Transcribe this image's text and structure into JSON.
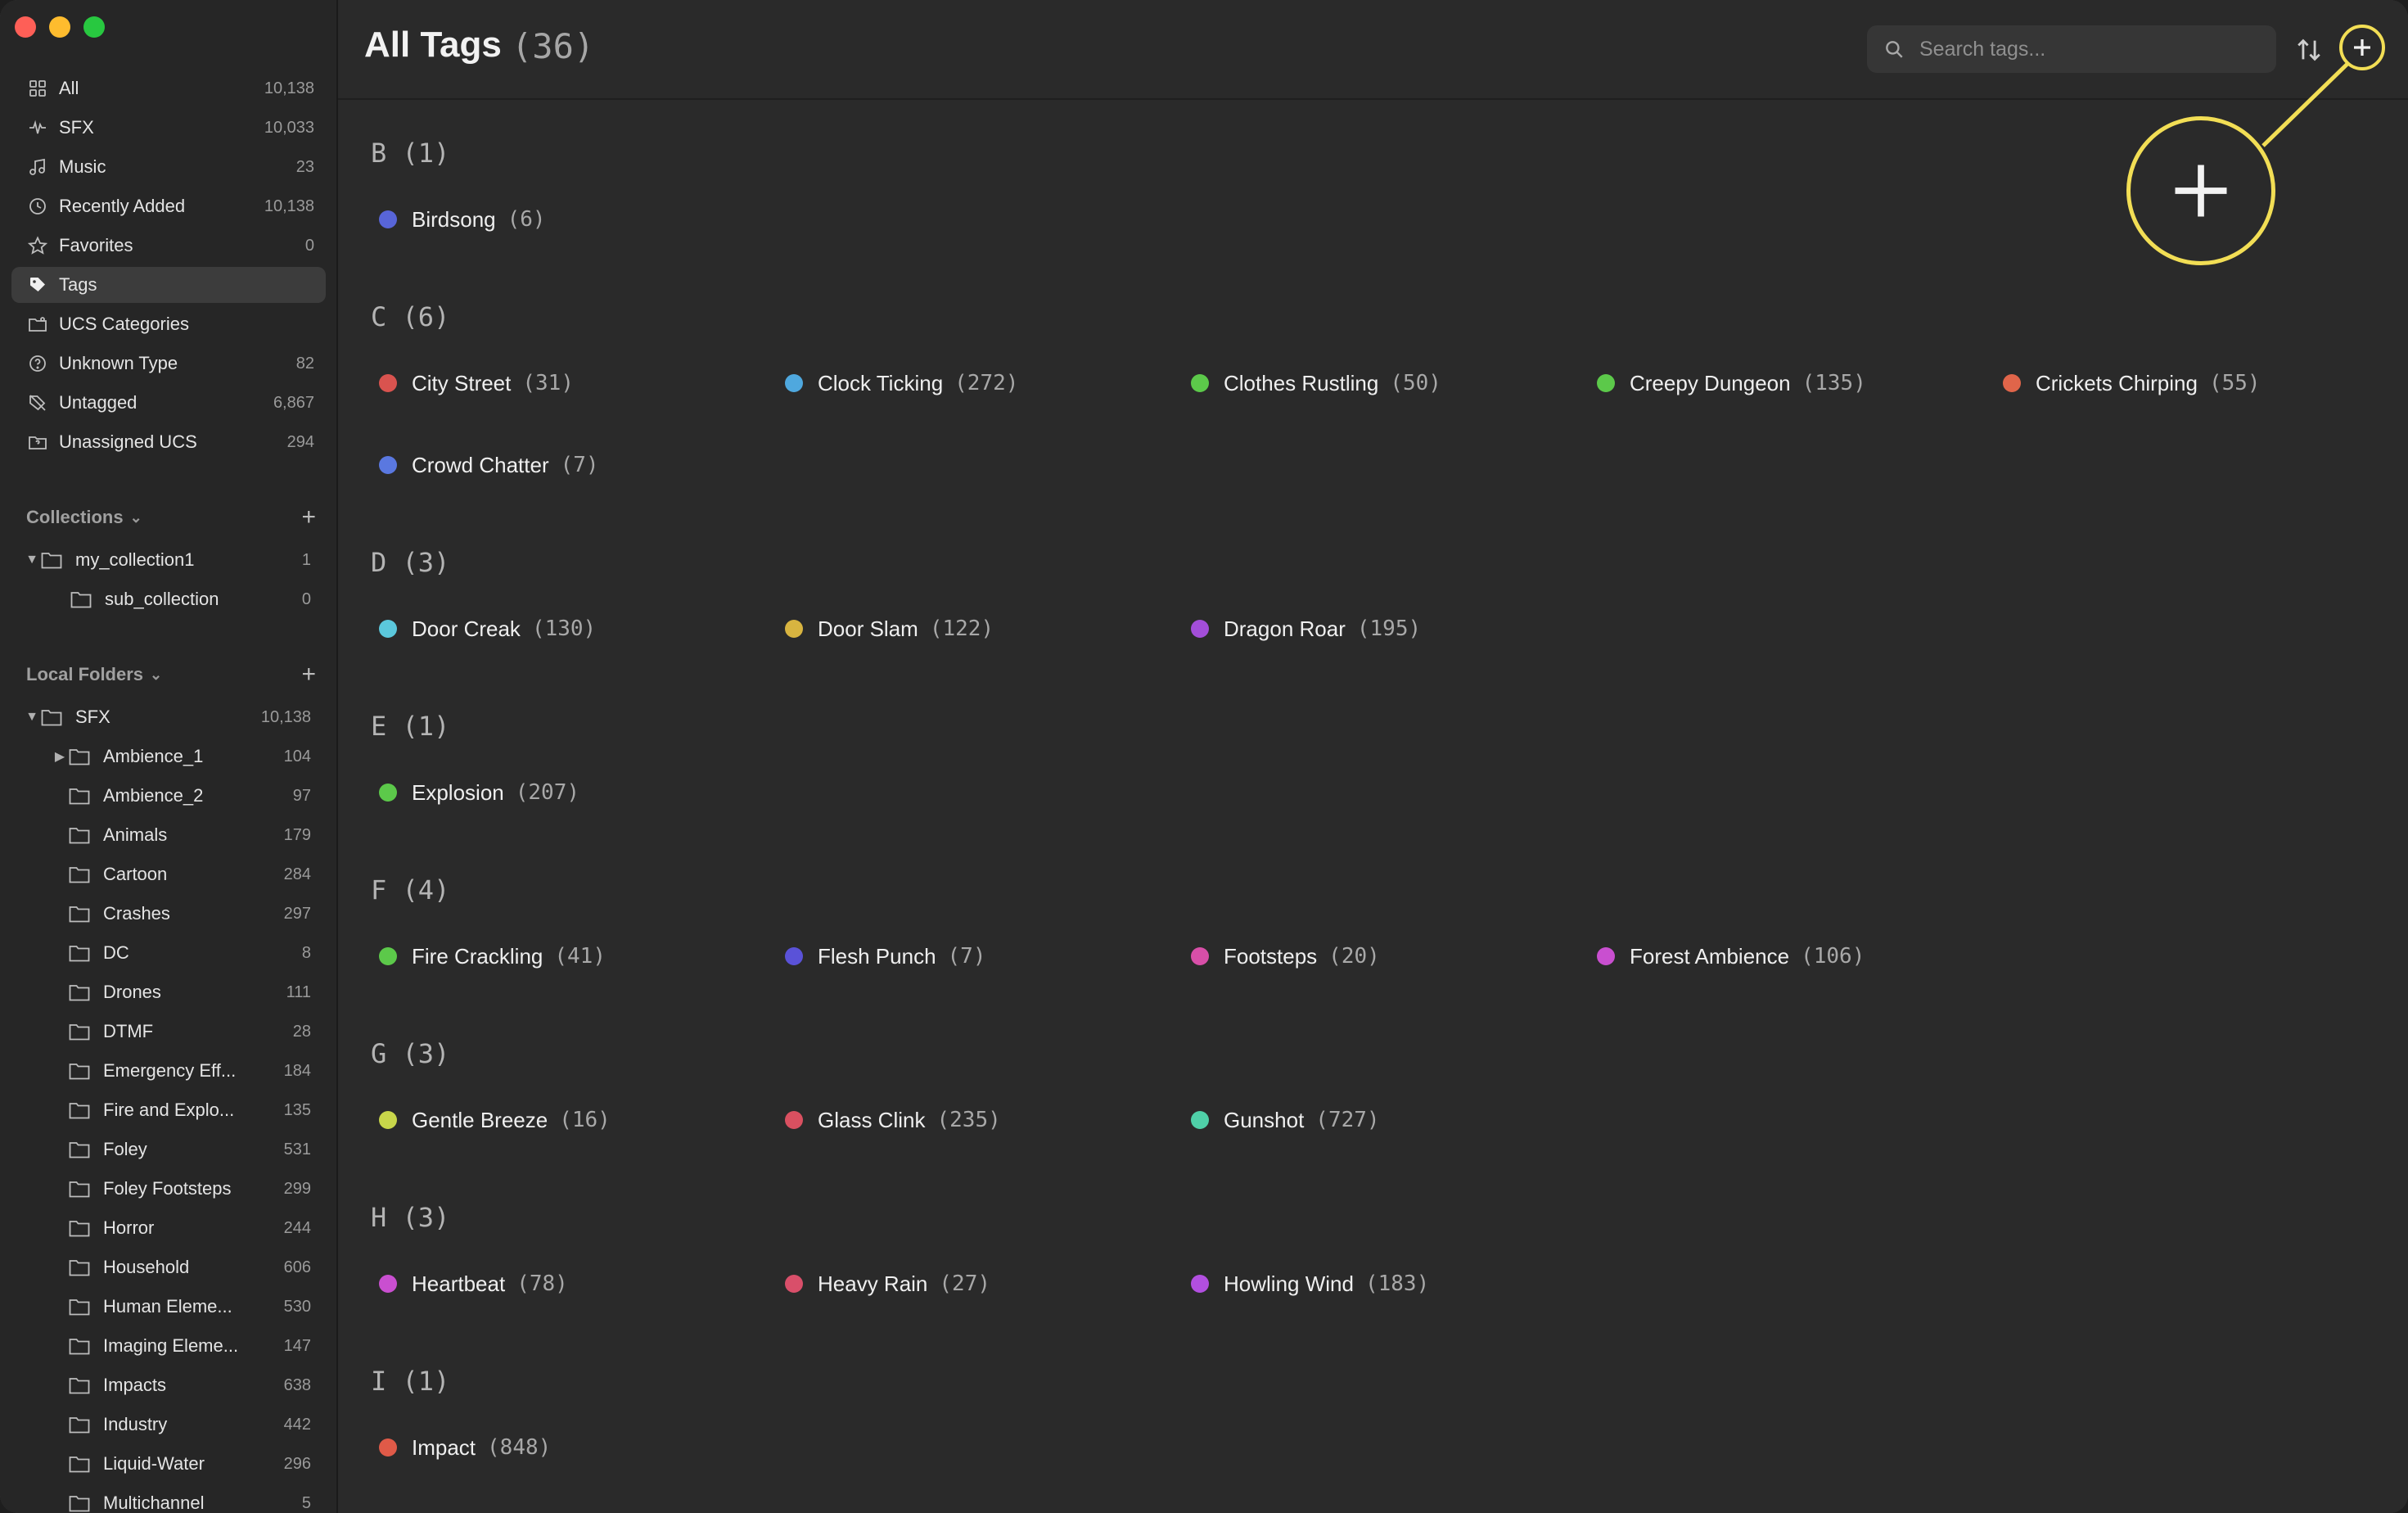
{
  "sidebar": {
    "library": [
      {
        "label": "All",
        "count": "10,138",
        "icon": "grid-icon"
      },
      {
        "label": "SFX",
        "count": "10,033",
        "icon": "waveform-icon"
      },
      {
        "label": "Music",
        "count": "23",
        "icon": "music-note-icon"
      },
      {
        "label": "Recently Added",
        "count": "10,138",
        "icon": "clock-icon"
      },
      {
        "label": "Favorites",
        "count": "0",
        "icon": "star-icon"
      },
      {
        "label": "Tags",
        "count": "",
        "icon": "tag-icon"
      },
      {
        "label": "UCS Categories",
        "count": "",
        "icon": "folder-tag-icon"
      },
      {
        "label": "Unknown Type",
        "count": "82",
        "icon": "question-circle-icon"
      },
      {
        "label": "Untagged",
        "count": "6,867",
        "icon": "tag-slash-icon"
      },
      {
        "label": "Unassigned UCS",
        "count": "294",
        "icon": "folder-question-icon"
      }
    ],
    "collections": {
      "header": "Collections",
      "items": [
        {
          "label": "my_collection1",
          "count": "1"
        },
        {
          "label": "sub_collection",
          "count": "0"
        }
      ]
    },
    "local_folders": {
      "header": "Local Folders",
      "root": {
        "label": "SFX",
        "count": "10,138"
      },
      "items": [
        {
          "label": "Ambience_1",
          "count": "104"
        },
        {
          "label": "Ambience_2",
          "count": "97"
        },
        {
          "label": "Animals",
          "count": "179"
        },
        {
          "label": "Cartoon",
          "count": "284"
        },
        {
          "label": "Crashes",
          "count": "297"
        },
        {
          "label": "DC",
          "count": "8"
        },
        {
          "label": "Drones",
          "count": "111"
        },
        {
          "label": "DTMF",
          "count": "28"
        },
        {
          "label": "Emergency Eff...",
          "count": "184"
        },
        {
          "label": "Fire and Explo...",
          "count": "135"
        },
        {
          "label": "Foley",
          "count": "531"
        },
        {
          "label": "Foley Footsteps",
          "count": "299"
        },
        {
          "label": "Horror",
          "count": "244"
        },
        {
          "label": "Household",
          "count": "606"
        },
        {
          "label": "Human Eleme...",
          "count": "530"
        },
        {
          "label": "Imaging Eleme...",
          "count": "147"
        },
        {
          "label": "Impacts",
          "count": "638"
        },
        {
          "label": "Industry",
          "count": "442"
        },
        {
          "label": "Liquid-Water",
          "count": "296"
        },
        {
          "label": "Multichannel",
          "count": "5"
        }
      ]
    }
  },
  "header": {
    "title": "All Tags",
    "count": "(36)",
    "search_placeholder": "Search tags..."
  },
  "groups": [
    {
      "heading": "B (1)",
      "tags": [
        {
          "name": "Birdsong",
          "count": "(6)",
          "color": "#5865d8"
        }
      ]
    },
    {
      "heading": "C (6)",
      "tags": [
        {
          "name": "City Street",
          "count": "(31)",
          "color": "#d9534f"
        },
        {
          "name": "Clock Ticking",
          "count": "(272)",
          "color": "#4fa8de"
        },
        {
          "name": "Clothes Rustling",
          "count": "(50)",
          "color": "#5cc94a"
        },
        {
          "name": "Creepy Dungeon",
          "count": "(135)",
          "color": "#5cc94a"
        },
        {
          "name": "Crickets Chirping",
          "count": "(55)",
          "color": "#e0654a"
        },
        {
          "name": "Crowd Chatter",
          "count": "(7)",
          "color": "#5a78e0"
        }
      ]
    },
    {
      "heading": "D (3)",
      "tags": [
        {
          "name": "Door Creak",
          "count": "(130)",
          "color": "#5bc8dc"
        },
        {
          "name": "Door Slam",
          "count": "(122)",
          "color": "#d8b440"
        },
        {
          "name": "Dragon Roar",
          "count": "(195)",
          "color": "#a34ed9"
        }
      ]
    },
    {
      "heading": "E (1)",
      "tags": [
        {
          "name": "Explosion",
          "count": "(207)",
          "color": "#5cc94a"
        }
      ]
    },
    {
      "heading": "F (4)",
      "tags": [
        {
          "name": "Fire Crackling",
          "count": "(41)",
          "color": "#5cc94a"
        },
        {
          "name": "Flesh Punch",
          "count": "(7)",
          "color": "#5a52d8"
        },
        {
          "name": "Footsteps",
          "count": "(20)",
          "color": "#d84fa8"
        },
        {
          "name": "Forest Ambience",
          "count": "(106)",
          "color": "#c94fd0"
        }
      ]
    },
    {
      "heading": "G (3)",
      "tags": [
        {
          "name": "Gentle Breeze",
          "count": "(16)",
          "color": "#c8d64a"
        },
        {
          "name": "Glass Clink",
          "count": "(235)",
          "color": "#d95060"
        },
        {
          "name": "Gunshot",
          "count": "(727)",
          "color": "#4fd0a8"
        }
      ]
    },
    {
      "heading": "H (3)",
      "tags": [
        {
          "name": "Heartbeat",
          "count": "(78)",
          "color": "#c94fd0"
        },
        {
          "name": "Heavy Rain",
          "count": "(27)",
          "color": "#d94f6a"
        },
        {
          "name": "Howling Wind",
          "count": "(183)",
          "color": "#b24fe0"
        }
      ]
    },
    {
      "heading": "I (1)",
      "tags": [
        {
          "name": "Impact",
          "count": "(848)",
          "color": "#e05a48"
        }
      ]
    }
  ]
}
